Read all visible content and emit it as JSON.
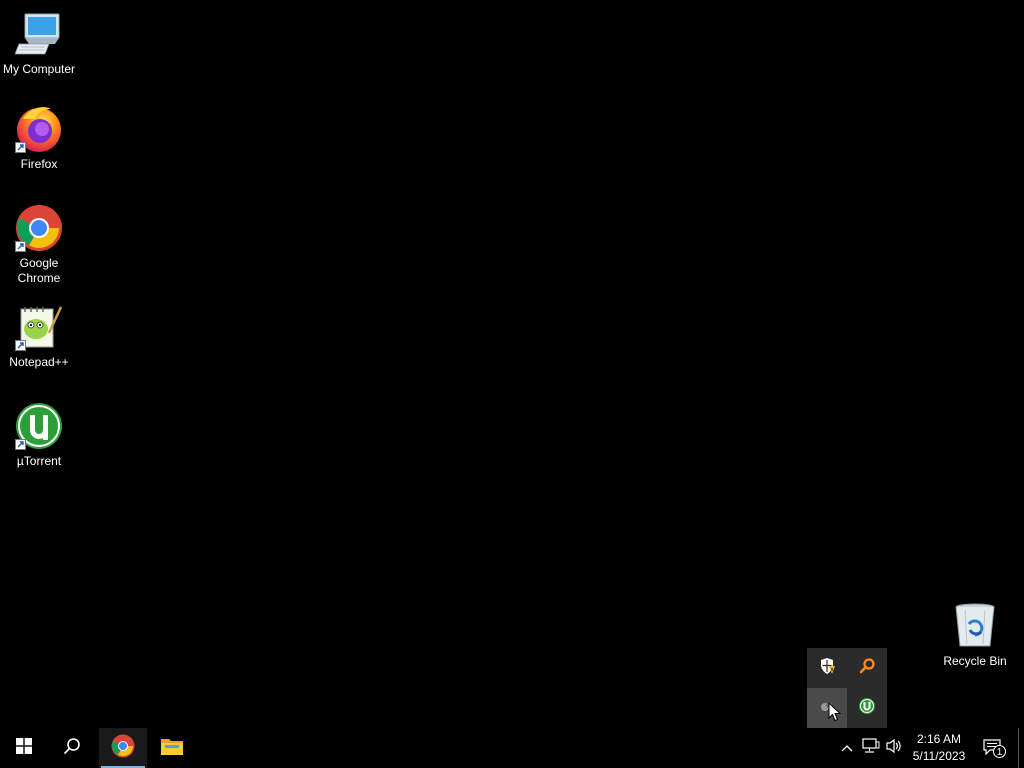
{
  "desktop": {
    "icons": [
      {
        "label": "My Computer"
      },
      {
        "label": "Firefox"
      },
      {
        "label": "Google Chrome"
      },
      {
        "label": "Notepad++"
      },
      {
        "label": "µTorrent"
      },
      {
        "label": "Recycle Bin"
      }
    ]
  },
  "tray_flyout": {
    "items": [
      "windows-security-icon",
      "search-tool-icon",
      "hidden-app-icon",
      "utorrent-tray-icon"
    ]
  },
  "taskbar": {
    "clock_time": "2:16 AM",
    "clock_date": "5/11/2023",
    "notification_count": "1"
  },
  "colors": {
    "background": "#000000",
    "taskbar_active_indicator": "#76b9ed",
    "flyout_bg": "#2b2b2b",
    "utorrent_green": "#2e9e3a"
  }
}
